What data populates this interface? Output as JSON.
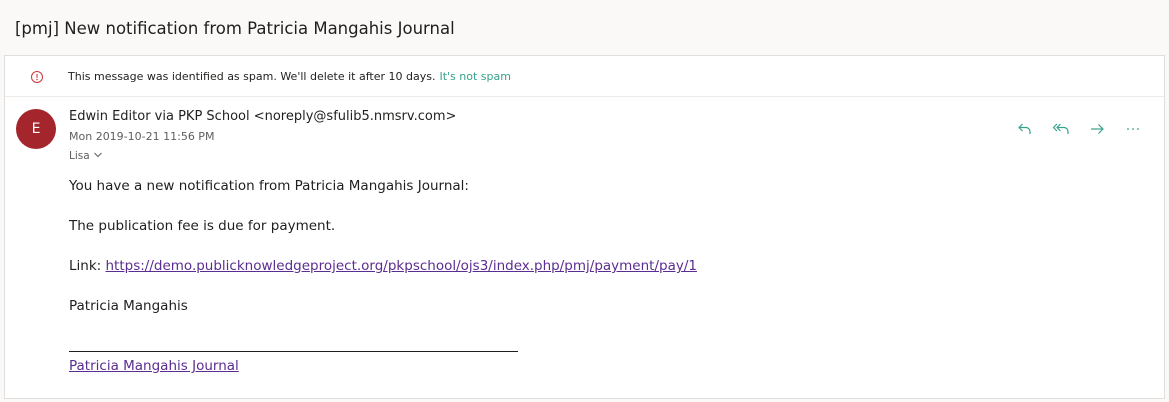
{
  "subject": "[pmj] New notification from Patricia Mangahis Journal",
  "spam_notice": {
    "text": "This message was identified as spam. We'll delete it after 10 days.",
    "action_label": "It's not spam"
  },
  "sender": {
    "avatar_initial": "E",
    "avatar_color": "#a4262c",
    "from": "Edwin Editor via PKP School <noreply@sfulib5.nmsrv.com>",
    "date": "Mon 2019-10-21 11:56 PM",
    "to": "Lisa"
  },
  "actions": [
    "reply-icon",
    "reply-all-icon",
    "forward-icon",
    "more-icon"
  ],
  "body": {
    "line1": "You have a new notification from Patricia Mangahis Journal:",
    "line2": "The publication fee is due for payment.",
    "link_prefix": "Link: ",
    "link_url": "https://demo.publicknowledgeproject.org/pkpschool/ojs3/index.php/pmj/payment/pay/1",
    "signature_name": "Patricia Mangahis",
    "signature_link": "Patricia Mangahis Journal"
  },
  "colors": {
    "accent": "#36a18c",
    "link": "#5c2d91",
    "warning": "#d13438"
  }
}
